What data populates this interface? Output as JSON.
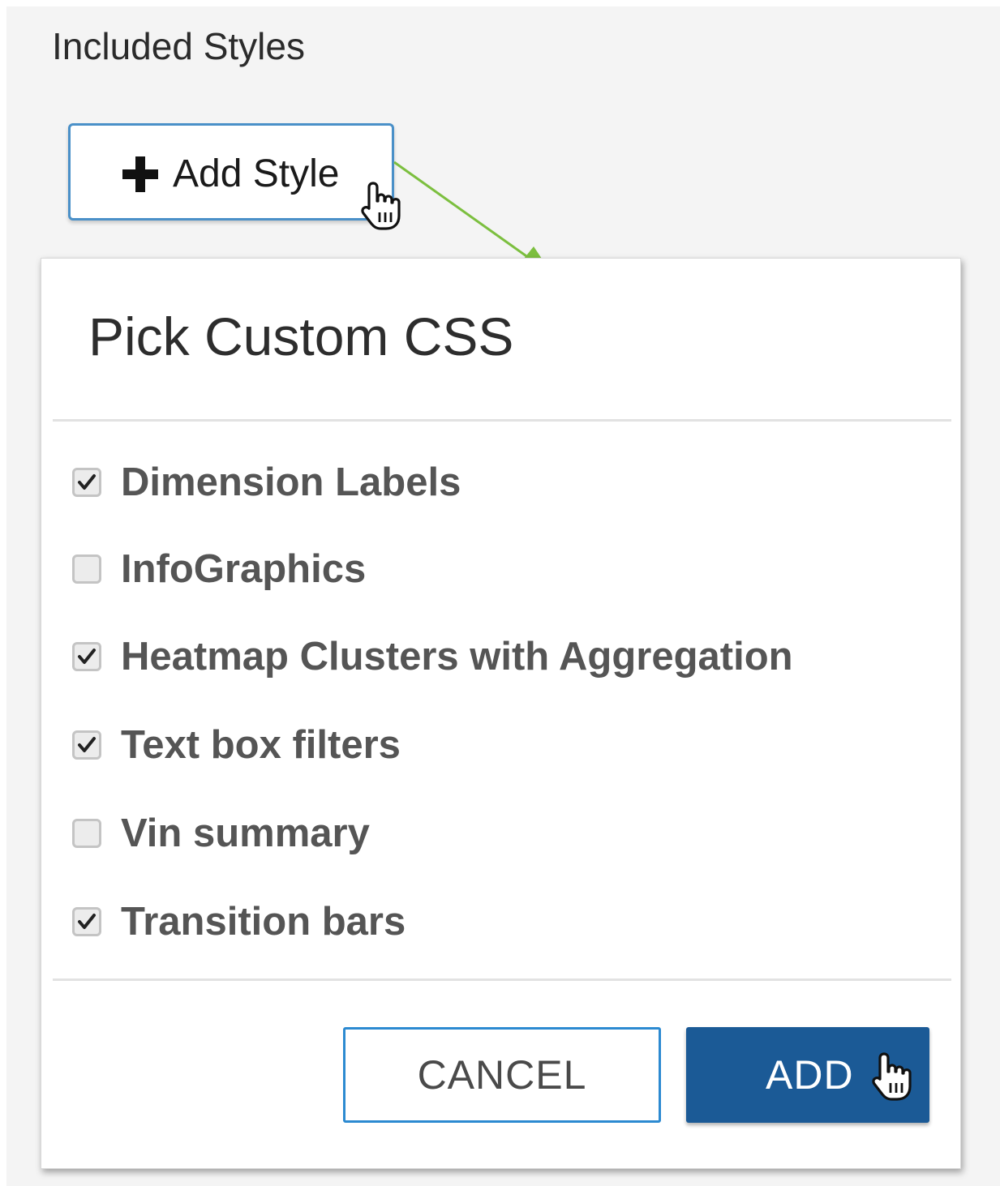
{
  "section": {
    "title": "Included Styles"
  },
  "add_style_button": {
    "label": "Add Style",
    "icon": "plus-icon"
  },
  "annotation": {
    "arrow_color": "#7cbf3f"
  },
  "dialog": {
    "title": "Pick Custom CSS",
    "options": [
      {
        "label": "Dimension Labels",
        "checked": true
      },
      {
        "label": "InfoGraphics",
        "checked": false
      },
      {
        "label": "Heatmap Clusters with Aggregation",
        "checked": true
      },
      {
        "label": "Text box filters",
        "checked": true
      },
      {
        "label": "Vin summary",
        "checked": false
      },
      {
        "label": "Transition bars",
        "checked": true
      }
    ],
    "cancel_label": "CANCEL",
    "add_label": "ADD"
  },
  "colors": {
    "panel_background": "#f4f4f4",
    "primary_button": "#1b5a96",
    "outline_button_border": "#2c8ad1"
  }
}
